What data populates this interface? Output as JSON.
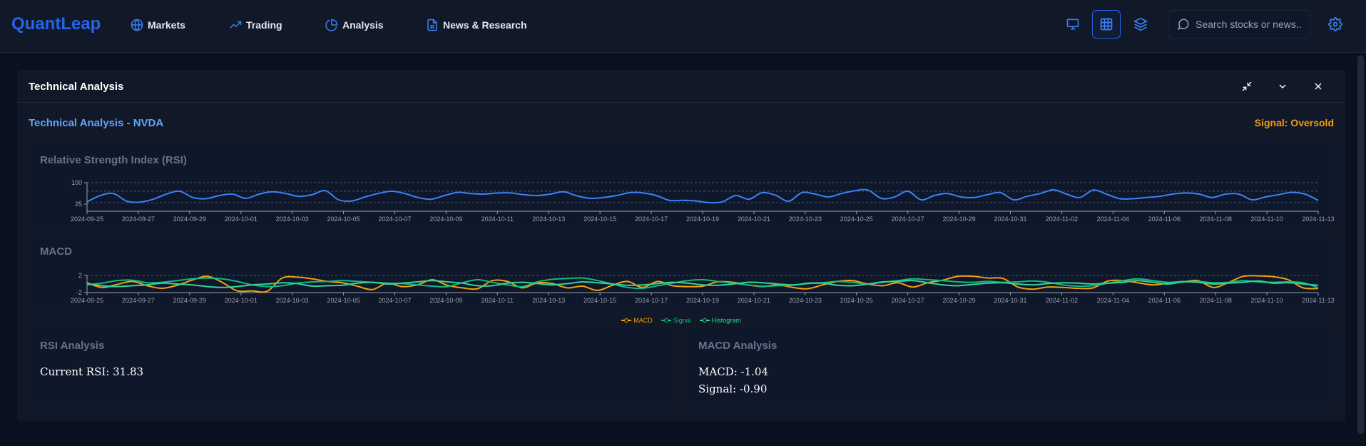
{
  "app": {
    "logo": "QuantLeap",
    "nav": [
      {
        "label": "Markets",
        "icon": "globe-icon"
      },
      {
        "label": "Trading",
        "icon": "trending-up-icon"
      },
      {
        "label": "Analysis",
        "icon": "pie-chart-icon"
      },
      {
        "label": "News & Research",
        "icon": "document-icon"
      }
    ],
    "toolbar": {
      "buttons": [
        "monitor-icon",
        "grid-icon",
        "layers-icon"
      ],
      "active": "grid-icon"
    },
    "search": {
      "placeholder": "Search stocks or news..."
    },
    "accent_color": "#2563eb"
  },
  "panel": {
    "title": "Technical Analysis",
    "subtitle": "Technical Analysis - NVDA",
    "signal": "Signal: Oversold",
    "signal_color": "#f59e0b"
  },
  "rsi_chart": {
    "title": "Relative Strength Index (RSI)"
  },
  "macd_chart": {
    "title": "MACD"
  },
  "rsi_analysis": {
    "title": "RSI Analysis",
    "current": "Current RSI: 31.83"
  },
  "macd_analysis": {
    "title": "MACD Analysis",
    "macd": "MACD: -1.04",
    "signal": "Signal: -0.90"
  },
  "chart_data": [
    {
      "type": "line",
      "title": "Relative Strength Index (RSI)",
      "x_ticks": [
        "2024-09-25",
        "2024-09-27",
        "2024-09-29",
        "2024-10-01",
        "2024-10-03",
        "2024-10-05",
        "2024-10-07",
        "2024-10-09",
        "2024-10-11",
        "2024-10-13",
        "2024-10-15",
        "2024-10-17",
        "2024-10-19",
        "2024-10-21",
        "2024-10-23",
        "2024-10-25",
        "2024-10-27",
        "2024-10-29",
        "2024-10-31",
        "2024-11-02",
        "2024-11-04",
        "2024-11-06",
        "2024-11-08",
        "2024-11-10",
        "2024-11-13"
      ],
      "y_ticks": [
        "25",
        "100"
      ],
      "ylim": [
        0,
        100
      ],
      "reference_lines": [
        30,
        70
      ],
      "series": [
        {
          "color": "#3b82f6",
          "values": [
            33,
            55,
            62,
            35,
            32,
            42,
            60,
            70,
            48,
            44,
            55,
            60,
            45,
            60,
            68,
            62,
            52,
            58,
            72,
            40,
            36,
            50,
            62,
            70,
            62,
            48,
            42,
            55,
            66,
            62,
            60,
            64,
            64,
            58,
            55,
            60,
            68,
            54,
            45,
            48,
            55,
            65,
            64,
            55,
            38,
            38,
            36,
            30,
            33,
            55,
            42,
            65,
            56,
            35,
            65,
            60,
            50,
            62,
            72,
            74,
            45,
            50,
            70,
            40,
            55,
            62,
            50,
            48,
            58,
            65,
            40,
            52,
            62,
            75,
            60,
            48,
            74,
            60,
            44,
            44,
            48,
            52,
            60,
            64,
            60,
            48,
            60,
            60,
            40,
            50,
            58,
            66,
            60,
            38
          ]
        }
      ]
    },
    {
      "type": "line",
      "title": "MACD",
      "x_ticks": [
        "2024-09-25",
        "2024-09-27",
        "2024-09-29",
        "2024-10-01",
        "2024-10-03",
        "2024-10-05",
        "2024-10-07",
        "2024-10-09",
        "2024-10-11",
        "2024-10-13",
        "2024-10-15",
        "2024-10-17",
        "2024-10-19",
        "2024-10-21",
        "2024-10-23",
        "2024-10-25",
        "2024-10-27",
        "2024-10-29",
        "2024-10-31",
        "2024-11-02",
        "2024-11-04",
        "2024-11-06",
        "2024-11-08",
        "2024-11-10",
        "2024-11-13"
      ],
      "y_ticks": [
        "-2",
        "2"
      ],
      "ylim": [
        -2,
        2
      ],
      "series": [
        {
          "name": "MACD",
          "color": "#f59e0b",
          "values": [
            0.3,
            -0.8,
            -0.1,
            0.6,
            -0.4,
            -1.0,
            -0.3,
            0.9,
            1.8,
            0.4,
            -1.6,
            -1.6,
            -1.7,
            1.4,
            1.6,
            1.2,
            0.6,
            0.3,
            -0.5,
            -1.3,
            0.2,
            -0.6,
            -0.2,
            1.0,
            -0.3,
            -0.9,
            -1.1,
            0.8,
            0.6,
            -0.9,
            0.3,
            0.1,
            -0.9,
            -0.5,
            -1.5,
            -0.3,
            0.6,
            -0.8,
            0.6,
            -0.4,
            -0.6,
            -0.5,
            0.5,
            0.4,
            -0.2,
            -0.6,
            -0.2,
            -0.8,
            -1.1,
            -0.2,
            0.6,
            0.8,
            0.0,
            -0.4,
            0.3,
            -0.7,
            0.3,
            0.9,
            1.8,
            1.8,
            1.4,
            1.3,
            -0.7,
            -1.2,
            -0.7,
            -0.8,
            -1.0,
            -0.9,
            0.7,
            0.8,
            0.3,
            -0.2,
            0.2,
            0.5,
            0.8,
            -0.8,
            0.3,
            1.8,
            1.9,
            1.7,
            1.0,
            -0.9,
            -1.04
          ]
        },
        {
          "name": "Signal",
          "color": "#10b981",
          "values": [
            -0.2,
            0.2,
            0.8,
            0.9,
            0.3,
            0.4,
            0.8,
            1.2,
            1.4,
            1.2,
            0.6,
            -0.2,
            -0.6,
            -0.4,
            0.2,
            0.5,
            0.6,
            0.8,
            0.6,
            0.4,
            0.2,
            0.1,
            -0.2,
            -0.5,
            -0.6,
            0.3,
            1.0,
            0.4,
            -0.2,
            -0.6,
            0.5,
            1.1,
            1.3,
            1.4,
            0.8,
            0.0,
            -0.8,
            -1.0,
            -0.4,
            0.2,
            0.8,
            1.0,
            0.6,
            0.2,
            -0.2,
            -0.5,
            -0.4,
            -0.3,
            0.2,
            0.3,
            0.6,
            0.4,
            0.0,
            0.4,
            0.8,
            1.2,
            1.0,
            0.8,
            0.5,
            0.4,
            0.6,
            0.4,
            0.5,
            0.7,
            0.4,
            -0.2,
            -0.5,
            -0.4,
            0.2,
            0.8,
            1.2,
            0.8,
            0.4,
            0.6,
            0.6,
            0.3,
            0.4,
            0.8,
            0.5,
            0.4,
            0.5,
            0.3,
            -0.9
          ]
        },
        {
          "name": "Histogram",
          "color": "#34d399",
          "values": [
            0.1,
            -0.4,
            -0.6,
            -0.4,
            -0.2,
            0.2,
            0.0,
            -0.2,
            -0.6,
            -0.8,
            -0.6,
            -0.2,
            0.0,
            0.3,
            0.1,
            -0.5,
            -0.4,
            -0.3,
            0.2,
            0.4,
            0.0,
            0.2,
            0.5,
            0.8,
            0.5,
            0.2,
            -0.4,
            -0.4,
            0.2,
            0.4,
            0.1,
            -0.2,
            0.1,
            0.5,
            0.3,
            0.0,
            -0.3,
            -0.2,
            0.1,
            0.4,
            0.2,
            -0.2,
            -0.3,
            0.0,
            0.4,
            0.3,
            0.0,
            -0.2,
            0.1,
            0.2,
            -0.3,
            -0.4,
            0.0,
            0.5,
            0.6,
            0.8,
            0.3,
            -0.2,
            -0.4,
            -0.1,
            0.2,
            0.3,
            0.0,
            -0.2,
            0.1,
            0.3,
            0.2,
            0.0,
            0.2,
            0.4,
            0.8,
            0.4,
            0.0,
            0.5,
            0.4,
            0.0,
            0.2,
            0.4,
            0.7,
            0.2,
            0.3,
            0.0,
            -0.3
          ]
        }
      ]
    }
  ]
}
